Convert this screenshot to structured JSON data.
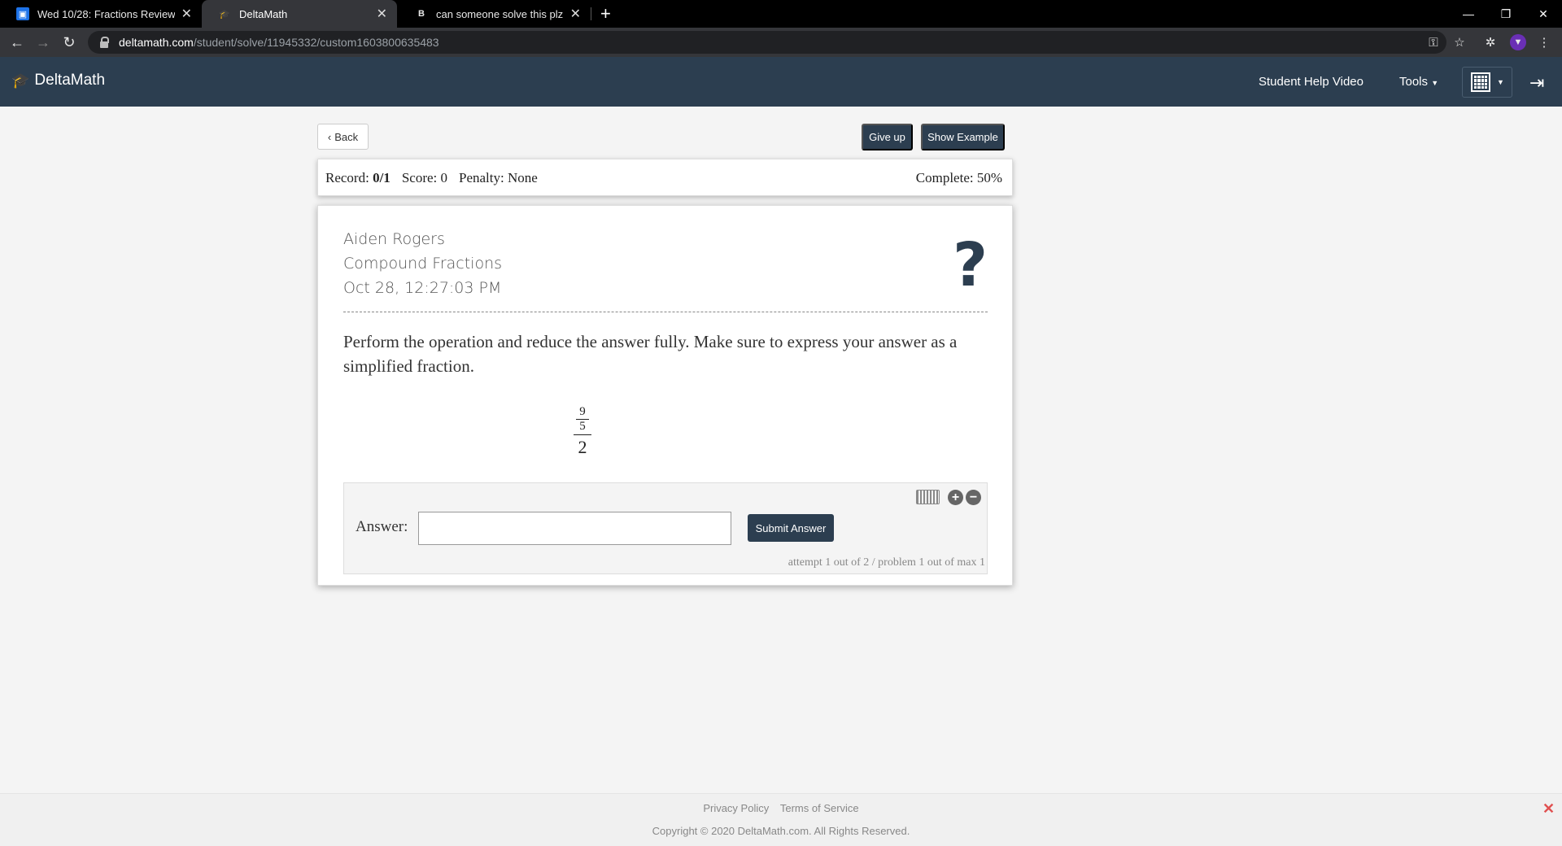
{
  "browser": {
    "tabs": [
      {
        "title": "Wed 10/28: Fractions Review",
        "icon": "classroom-icon",
        "active": false
      },
      {
        "title": "DeltaMath",
        "icon": "mortarboard-icon",
        "active": true
      },
      {
        "title": "can someone solve this plz - Brai",
        "icon": "brainly-icon",
        "active": false
      }
    ],
    "close_glyph": "✕",
    "new_tab_glyph": "+",
    "url_host": "deltamath.com",
    "url_path": "/student/solve/11945332/custom1603800635483"
  },
  "header": {
    "brand": "DeltaMath",
    "help_video": "Student Help Video",
    "tools": "Tools"
  },
  "toolbar": {
    "back": "Back",
    "give_up": "Give up",
    "show_example": "Show Example"
  },
  "record": {
    "record_label": "Record:",
    "record_value": "0/1",
    "score": "Score: 0",
    "penalty": "Penalty: None",
    "complete": "Complete: 50%"
  },
  "problem": {
    "student": "Aiden Rogers",
    "topic": "Compound Fractions",
    "timestamp": "Oct 28, 12:27:03 PM",
    "prompt": "Perform the operation and reduce the answer fully. Make sure to express your answer as a simplified fraction.",
    "fraction": {
      "inner_num": "9",
      "inner_den": "5",
      "outer_den": "2"
    }
  },
  "answer": {
    "label": "Answer:",
    "value": "",
    "submit": "Submit Answer",
    "attempt": "attempt 1 out of 2 / problem 1 out of max 1"
  },
  "footer": {
    "privacy": "Privacy Policy",
    "terms": "Terms of Service",
    "copyright": "Copyright © 2020 DeltaMath.com. All Rights Reserved."
  },
  "colors": {
    "brand": "#2c3e50",
    "page_bg": "#f4f4f4"
  }
}
